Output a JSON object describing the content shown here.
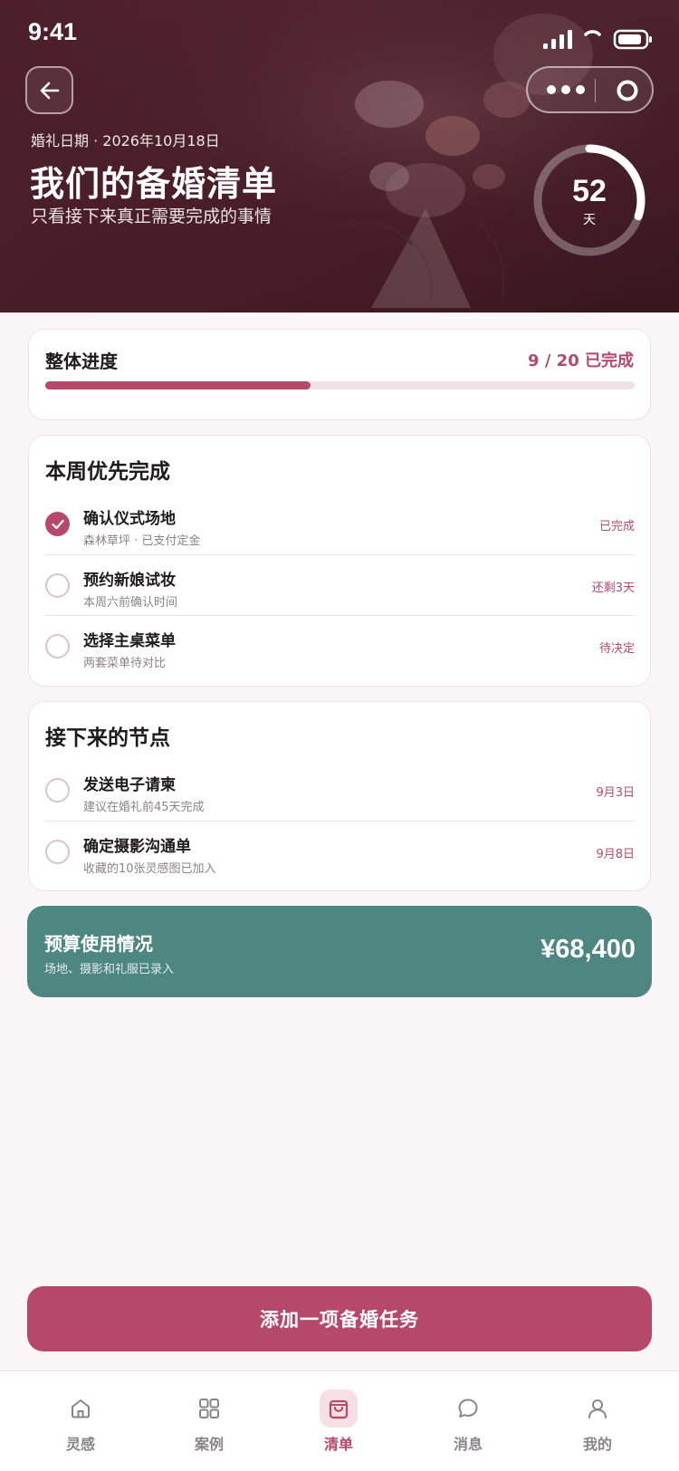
{
  "status_bar": {
    "time": "9:41"
  },
  "hero": {
    "wedding_date": "婚礼日期 · 2026年10月18日",
    "title": "我们的备婚清单",
    "subtitle": "只看接下来真正需要完成的事情",
    "countdown": {
      "value": "52",
      "unit": "天",
      "ring_progress_fraction": 0.3
    }
  },
  "progress": {
    "label": "整体进度",
    "count_text": "9 / 20 已完成",
    "completed": 9,
    "total": 20
  },
  "week_priorities": {
    "title": "本周优先完成",
    "tasks": [
      {
        "title": "确认仪式场地",
        "subtitle": "森林草坪 · 已支付定金",
        "status": "已完成",
        "done": true
      },
      {
        "title": "预约新娘试妆",
        "subtitle": "本周六前确认时间",
        "status": "还剩3天",
        "done": false
      },
      {
        "title": "选择主桌菜单",
        "subtitle": "两套菜单待对比",
        "status": "待决定",
        "done": false
      }
    ]
  },
  "upcoming": {
    "title": "接下来的节点",
    "tasks": [
      {
        "title": "发送电子请柬",
        "subtitle": "建议在婚礼前45天完成",
        "date": "9月3日",
        "done": false
      },
      {
        "title": "确定摄影沟通单",
        "subtitle": "收藏的10张灵感图已加入",
        "date": "9月8日",
        "done": false
      }
    ]
  },
  "budget": {
    "title": "预算使用情况",
    "subtitle": "场地、摄影和礼服已录入",
    "amount": "¥68,400"
  },
  "cta": {
    "label": "添加一项备婚任务"
  },
  "tabbar": {
    "items": [
      {
        "label": "灵感",
        "icon": "home-icon",
        "active": false
      },
      {
        "label": "案例",
        "icon": "grid-icon",
        "active": false
      },
      {
        "label": "清单",
        "icon": "shopping-bag-icon",
        "active": true
      },
      {
        "label": "消息",
        "icon": "chat-bubble-icon",
        "active": false
      },
      {
        "label": "我的",
        "icon": "user-icon",
        "active": false
      }
    ]
  },
  "colors": {
    "accent": "#b6486c",
    "budget_card": "#4e8681",
    "hero_overlay": "#4a1f2b",
    "page_background": "#faf5f6"
  }
}
